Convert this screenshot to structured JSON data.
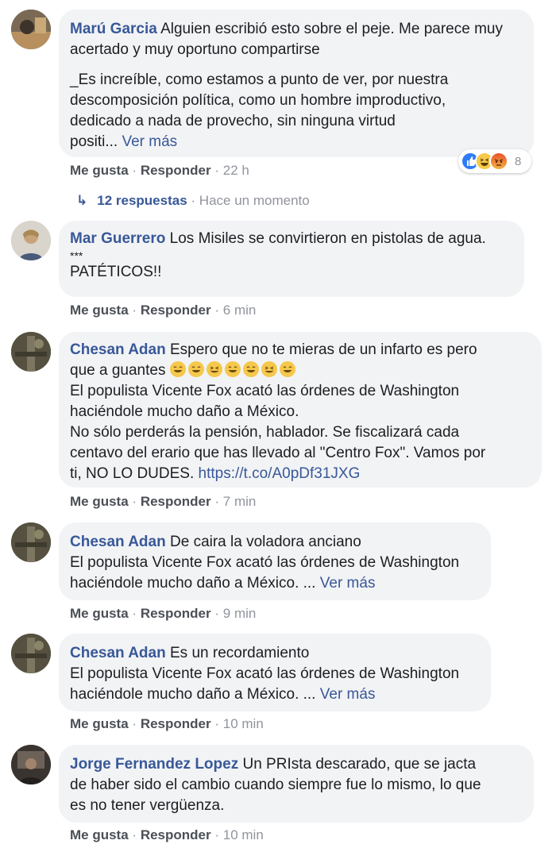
{
  "comments": [
    {
      "author": "Marú Garcia",
      "text1": "Alguien escribió esto sobre el peje. Me parece muy acertado y muy oportuno compartirse",
      "text2_lines": [
        "_Es increíble, como estamos a punto de ver, por nuestra",
        "descomposición política, como un hombre improductivo,",
        "dedicado a nada de provecho, sin ninguna virtud",
        "positi..."
      ],
      "more": "Ver más",
      "like": "Me gusta",
      "reply": "Responder",
      "time": "22 h",
      "reaction_count": "8",
      "replies_count": "12 respuestas",
      "replies_time": "Hace un momento"
    },
    {
      "author": "Mar Guerrero",
      "text1": "Los Misiles se convirtieron en pistolas de agua.",
      "text2": "***",
      "text3": "PATÉTICOS!!",
      "like": "Me gusta",
      "reply": "Responder",
      "time": "6 min"
    },
    {
      "author": "Chesan Adan",
      "text1a": "Espero que no te mieras de un infarto es pero",
      "text1b": "que a guantes",
      "lines": [
        "El populista Vicente Fox acató las órdenes de Washington",
        "haciéndole mucho daño a México.",
        "No sólo perderás la pensión, hablador. Se fiscalizará cada",
        "centavo del erario que has llevado al \"Centro Fox\". Vamos por",
        "ti, NO LO DUDES."
      ],
      "link": "https://t.co/A0pDf31JXG",
      "like": "Me gusta",
      "reply": "Responder",
      "time": "7 min"
    },
    {
      "author": "Chesan Adan",
      "text1": "De caira la voladora anciano",
      "line2": "El populista Vicente Fox acató las órdenes de Washington",
      "line3": "haciéndole mucho daño a México. ...",
      "more": "Ver más",
      "like": "Me gusta",
      "reply": "Responder",
      "time": "9 min"
    },
    {
      "author": "Chesan Adan",
      "text1": "Es un recordamiento",
      "line2": "El populista Vicente Fox acató las órdenes de Washington",
      "line3": "haciéndole mucho daño a México. ...",
      "more": "Ver más",
      "like": "Me gusta",
      "reply": "Responder",
      "time": "10 min"
    },
    {
      "author": "Jorge Fernandez Lopez",
      "text1": "Un PRIsta descarado, que se jacta",
      "line2": "de haber sido el cambio cuando siempre fue lo mismo, lo que",
      "line3": "es no tener vergüenza.",
      "like": "Me gusta",
      "reply": "Responder",
      "time": "10 min"
    }
  ],
  "separator": "·",
  "reply_arrow": "↳",
  "icons": {
    "reactions": [
      "like-reaction-icon",
      "haha-reaction-icon",
      "angry-reaction-icon"
    ],
    "emoji": "laughing-emoji-icon"
  },
  "colors": {
    "name": "#385898",
    "bubble": "#f2f3f5",
    "meta": "#90949c",
    "action": "#4b4f56"
  }
}
